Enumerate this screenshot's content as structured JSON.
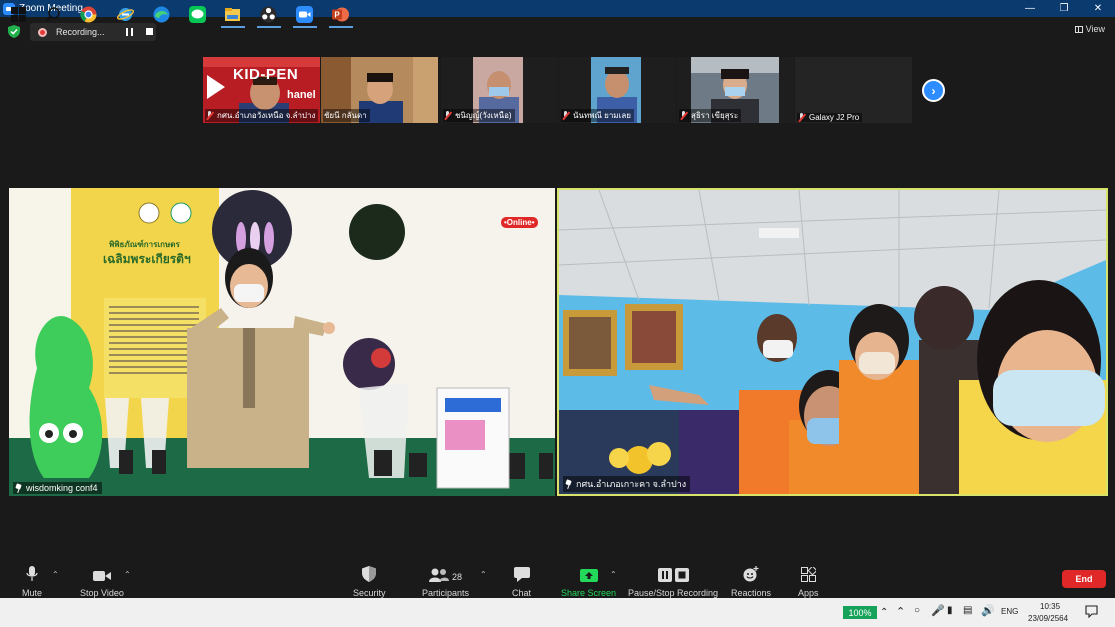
{
  "window": {
    "title": "Zoom Meeting"
  },
  "recording": {
    "label": "Recording..."
  },
  "view": {
    "label": "View"
  },
  "thumbnails": [
    {
      "name": "กศน.อำเภอวังเหนือ จ.ลำปาง",
      "muted": true
    },
    {
      "name": "ชัยนี กลันดา",
      "muted": false
    },
    {
      "name": "ชนิญญ์(วังเหนือ)",
      "muted": true
    },
    {
      "name": "นันทพณี ยามเลย",
      "muted": true
    },
    {
      "name": "สุธิรา เขียฺสุระ",
      "muted": true
    },
    {
      "name": "Galaxy J2 Pro",
      "muted": true
    }
  ],
  "thumbnail_texts": {
    "kidpen_top": "KID-PEN",
    "kidpen_bottom": "hanel"
  },
  "main_videos": [
    {
      "name": "wisdomking conf4"
    },
    {
      "name": "กศน.อำเภอเกาะคา จ.ลำปาง"
    }
  ],
  "booth_texts": {
    "museum_line1": "พิพิธภัณฑ์การเกษตร",
    "museum_line2": "เฉลิมพระเกียรติฯ",
    "online_badge": "•Online•"
  },
  "toolbar": {
    "mute": "Mute",
    "stop_video": "Stop Video",
    "security": "Security",
    "participants": "Participants",
    "participants_count": "28",
    "chat": "Chat",
    "share_screen": "Share Screen",
    "pause_stop_recording": "Pause/Stop Recording",
    "reactions": "Reactions",
    "apps": "Apps",
    "end": "End"
  },
  "taskbar": {
    "battery": "100%",
    "language": "ENG",
    "time": "10:35",
    "date": "23/09/2564"
  },
  "colors": {
    "zoom_blue": "#2d8cff",
    "end_red": "#e02828",
    "share_green": "#23d959",
    "active_speaker": "#d8e36a"
  }
}
